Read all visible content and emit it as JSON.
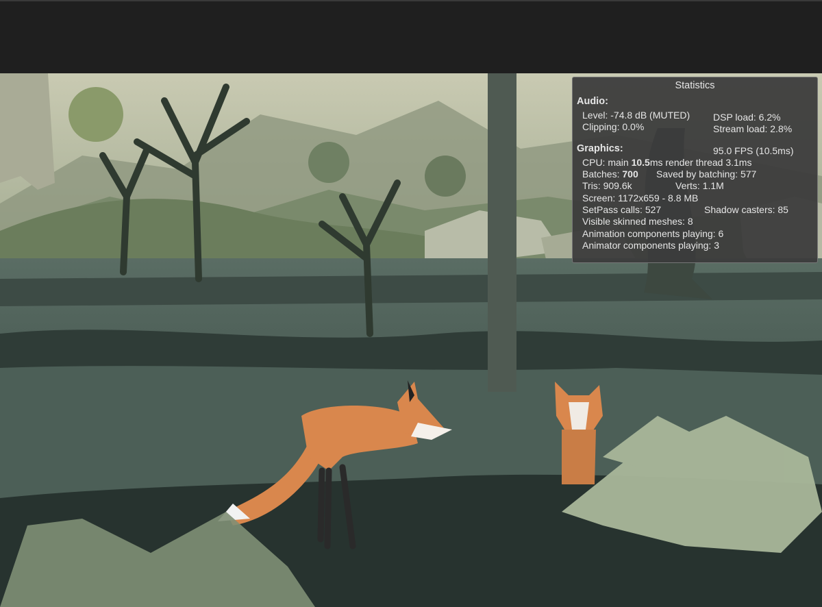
{
  "statistics": {
    "title": "Statistics",
    "audio": {
      "heading": "Audio:",
      "level": "Level: -74.8 dB (MUTED)",
      "clipping": "Clipping: 0.0%",
      "dsp_load": "DSP load: 6.2%",
      "stream_load": "Stream load: 2.8%"
    },
    "graphics": {
      "heading": "Graphics:",
      "fps": "95.0 FPS (10.5ms)",
      "cpu_prefix": "CPU: main ",
      "cpu_main": "10.5",
      "cpu_suffix": "ms  render thread 3.1ms",
      "batches_prefix": "Batches: ",
      "batches": "700",
      "saved_by_batching": "Saved by batching: 577",
      "tris": "Tris: 909.6k",
      "verts": "Verts: 1.1M",
      "screen": "Screen: 1172x659 - 8.8 MB",
      "setpass": "SetPass calls: 527",
      "shadow_casters": "Shadow casters: 85",
      "skinned_meshes": "Visible skinned meshes: 8",
      "animation_components": "Animation components playing: 6",
      "animator_components": "Animator components playing: 3"
    }
  },
  "colors": {
    "toolbar_bg": "#1f1f1f",
    "panel_bg": "#3c3c3c",
    "panel_text": "#e6e6e6",
    "fox_orange": "#d9874d"
  }
}
